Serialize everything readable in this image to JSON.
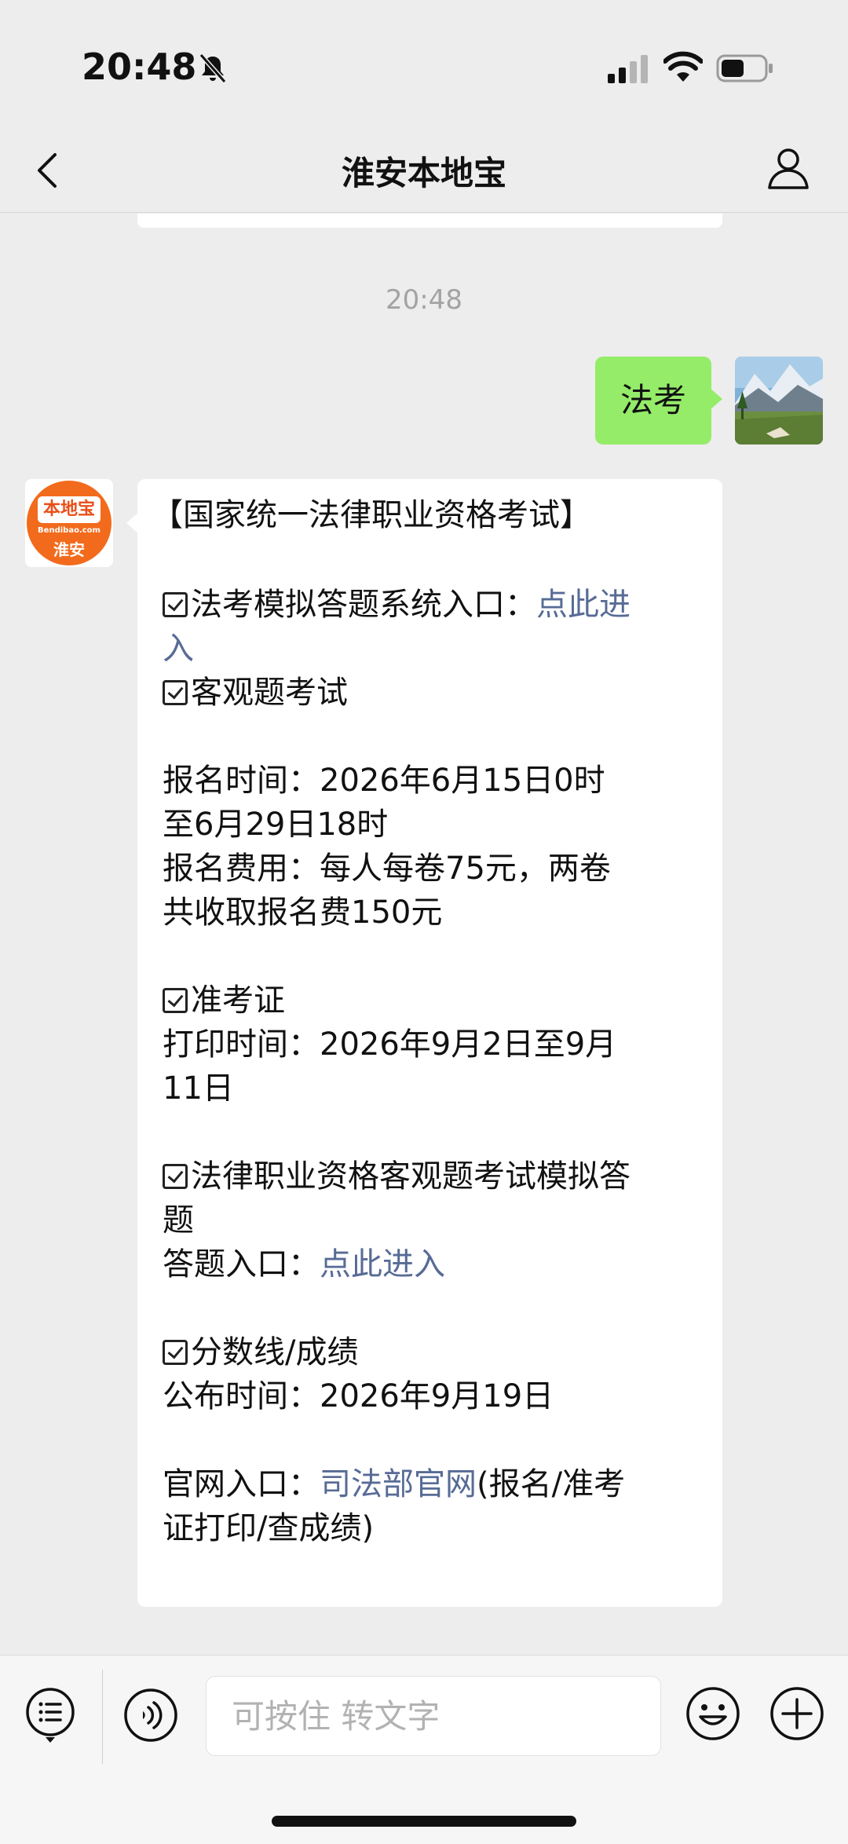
{
  "status_bar": {
    "time": "20:48"
  },
  "nav": {
    "title": "淮安本地宝"
  },
  "chat": {
    "timestamp": "20:48",
    "sent_message": "法考",
    "bot_logo": {
      "top": "本地宝",
      "mid": "Bendibao.com",
      "bottom": "淮安"
    },
    "reply_lines": [
      {
        "text": "【国家统一法律职业资格考试】",
        "link": ""
      },
      {
        "text": "法考模拟答题系统入口：",
        "link": "点此进",
        "checkbox": true
      },
      {
        "text": "",
        "link": "入"
      },
      {
        "text": "客观题考试",
        "link": "",
        "checkbox": true
      },
      {
        "text": "报名时间：2026年6月15日0时",
        "link": ""
      },
      {
        "text": "至6月29日18时",
        "link": ""
      },
      {
        "text": "报名费用：每人每卷75元，两卷",
        "link": ""
      },
      {
        "text": "共收取报名费150元",
        "link": ""
      },
      {
        "text": "准考证",
        "link": "",
        "checkbox": true
      },
      {
        "text": "打印时间：2026年9月2日至9月",
        "link": ""
      },
      {
        "text": "11日",
        "link": ""
      },
      {
        "text": "法律职业资格客观题考试模拟答",
        "link": "",
        "checkbox": true
      },
      {
        "text": "题",
        "link": ""
      },
      {
        "text": "答题入口：",
        "link": "点此进入"
      },
      {
        "text": "分数线/成绩",
        "link": "",
        "checkbox": true
      },
      {
        "text": "公布时间：2026年9月19日",
        "link": ""
      },
      {
        "text": "官网入口：",
        "link": "司法部官网",
        "after": "(报名/准考"
      },
      {
        "text": "证打印/查成绩)",
        "link": ""
      }
    ]
  },
  "input_bar": {
    "placeholder": "可按住 转文字"
  },
  "colors": {
    "background": "#ededed",
    "sent_bubble": "#95ec69",
    "link": "#576b95",
    "logo_orange": "#f26b1d"
  },
  "icons": [
    "bell-off-icon",
    "signal-icon",
    "wifi-icon",
    "battery-icon",
    "back-icon",
    "profile-icon",
    "menu-list-icon",
    "voice-icon",
    "emoji-icon",
    "plus-icon"
  ]
}
